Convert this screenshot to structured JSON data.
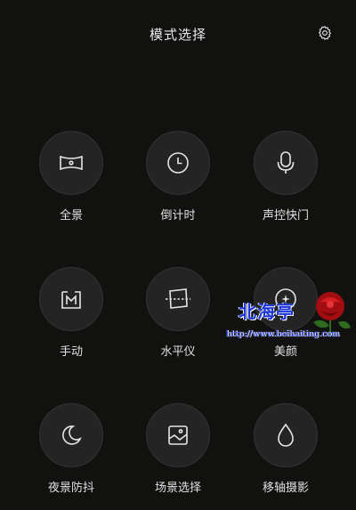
{
  "header": {
    "title": "模式选择",
    "settings_icon": "gear-icon"
  },
  "modes": [
    {
      "label": "全景",
      "icon": "panorama-icon"
    },
    {
      "label": "倒计时",
      "icon": "clock-icon"
    },
    {
      "label": "声控快门",
      "icon": "microphone-icon"
    },
    {
      "label": "手动",
      "icon": "manual-m-icon"
    },
    {
      "label": "水平仪",
      "icon": "level-icon"
    },
    {
      "label": "美颜",
      "icon": "beauty-icon"
    },
    {
      "label": "夜景防抖",
      "icon": "moon-icon"
    },
    {
      "label": "场景选择",
      "icon": "scene-icon"
    },
    {
      "label": "移轴摄影",
      "icon": "tilt-shift-icon"
    }
  ],
  "watermark": {
    "title": "北海亭",
    "url": "http://www.beihaiting.com"
  },
  "colors": {
    "background": "#111210",
    "circle": "#242424",
    "text": "#e0e0e0",
    "watermark": "#1c34d6"
  }
}
